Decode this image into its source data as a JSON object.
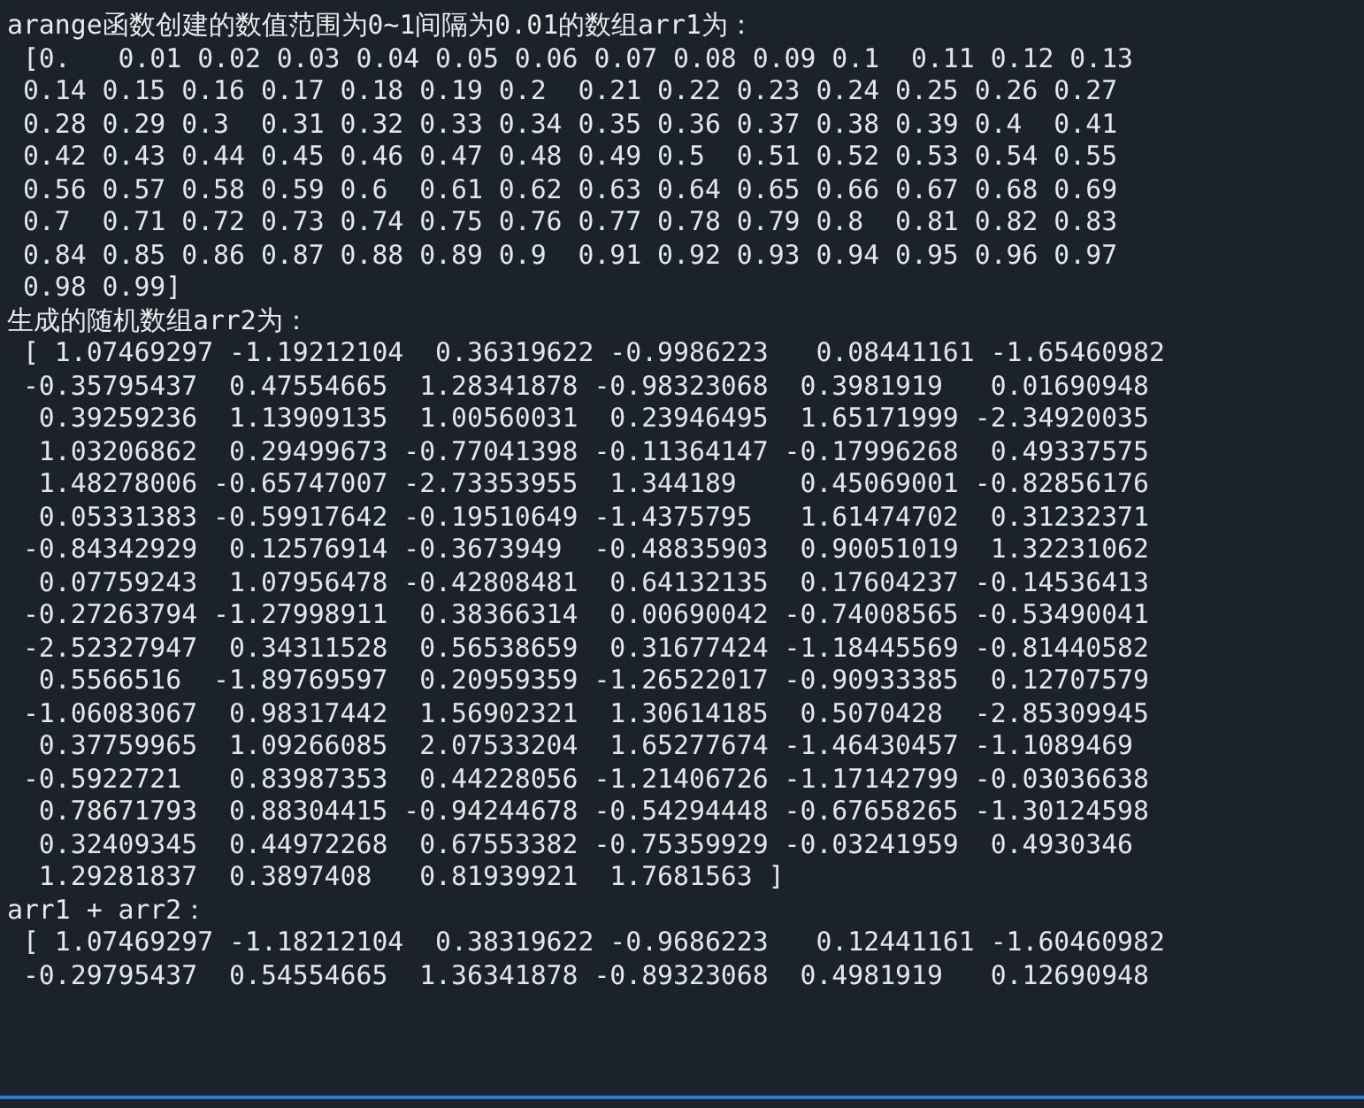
{
  "sections": [
    {
      "heading": "arange函数创建的数值范围为0~1间隔为0.01的数组arr1为：",
      "lines": [
        " [0.   0.01 0.02 0.03 0.04 0.05 0.06 0.07 0.08 0.09 0.1  0.11 0.12 0.13",
        " 0.14 0.15 0.16 0.17 0.18 0.19 0.2  0.21 0.22 0.23 0.24 0.25 0.26 0.27",
        " 0.28 0.29 0.3  0.31 0.32 0.33 0.34 0.35 0.36 0.37 0.38 0.39 0.4  0.41",
        " 0.42 0.43 0.44 0.45 0.46 0.47 0.48 0.49 0.5  0.51 0.52 0.53 0.54 0.55",
        " 0.56 0.57 0.58 0.59 0.6  0.61 0.62 0.63 0.64 0.65 0.66 0.67 0.68 0.69",
        " 0.7  0.71 0.72 0.73 0.74 0.75 0.76 0.77 0.78 0.79 0.8  0.81 0.82 0.83",
        " 0.84 0.85 0.86 0.87 0.88 0.89 0.9  0.91 0.92 0.93 0.94 0.95 0.96 0.97",
        " 0.98 0.99]"
      ]
    },
    {
      "heading": "生成的随机数组arr2为：",
      "lines": [
        " [ 1.07469297 -1.19212104  0.36319622 -0.9986223   0.08441161 -1.65460982",
        " -0.35795437  0.47554665  1.28341878 -0.98323068  0.3981919   0.01690948",
        "  0.39259236  1.13909135  1.00560031  0.23946495  1.65171999 -2.34920035",
        "  1.03206862  0.29499673 -0.77041398 -0.11364147 -0.17996268  0.49337575",
        "  1.48278006 -0.65747007 -2.73353955  1.344189    0.45069001 -0.82856176",
        "  0.05331383 -0.59917642 -0.19510649 -1.4375795   1.61474702  0.31232371",
        " -0.84342929  0.12576914 -0.3673949  -0.48835903  0.90051019  1.32231062",
        "  0.07759243  1.07956478 -0.42808481  0.64132135  0.17604237 -0.14536413",
        " -0.27263794 -1.27998911  0.38366314  0.00690042 -0.74008565 -0.53490041",
        " -2.52327947  0.34311528  0.56538659  0.31677424 -1.18445569 -0.81440582",
        "  0.5566516  -1.89769597  0.20959359 -1.26522017 -0.90933385  0.12707579",
        " -1.06083067  0.98317442  1.56902321  1.30614185  0.5070428  -2.85309945",
        "  0.37759965  1.09266085  2.07533204  1.65277674 -1.46430457 -1.1089469",
        " -0.5922721   0.83987353  0.44228056 -1.21406726 -1.17142799 -0.03036638",
        "  0.78671793  0.88304415 -0.94244678 -0.54294448 -0.67658265 -1.30124598",
        "  0.32409345  0.44972268  0.67553382 -0.75359929 -0.03241959  0.4930346",
        "  1.29281837  0.3897408   0.81939921  1.7681563 ]"
      ]
    },
    {
      "heading": "arr1 + arr2：",
      "lines": [
        " [ 1.07469297 -1.18212104  0.38319622 -0.9686223   0.12441161 -1.60460982",
        " -0.29795437  0.54554665  1.36341878 -0.89323068  0.4981919   0.12690948"
      ]
    }
  ]
}
